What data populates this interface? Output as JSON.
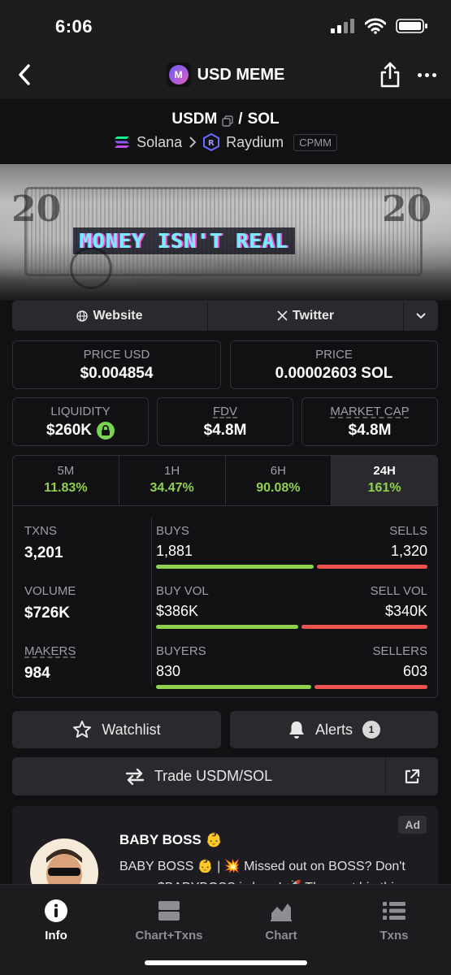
{
  "status_bar": {
    "time": "6:06"
  },
  "nav": {
    "title": "USD MEME",
    "logo_letter": "M"
  },
  "pair": {
    "base": "USDM",
    "separator": "/",
    "quote": "SOL",
    "chain": "Solana",
    "dex": "Raydium",
    "pool_type": "CPMM"
  },
  "banner": {
    "text": "MONEY ISN'T REAL"
  },
  "links": {
    "website": "Website",
    "twitter": "Twitter"
  },
  "price": {
    "usd_label": "PRICE USD",
    "usd_value": "$0.004854",
    "native_label": "PRICE",
    "native_value": "0.00002603 SOL"
  },
  "metrics": {
    "liquidity_label": "LIQUIDITY",
    "liquidity_value": "$260K",
    "fdv_label": "FDV",
    "fdv_value": "$4.8M",
    "mcap_label": "MARKET CAP",
    "mcap_value": "$4.8M"
  },
  "timeframes": [
    {
      "label": "5M",
      "change": "11.83%"
    },
    {
      "label": "1H",
      "change": "34.47%"
    },
    {
      "label": "6H",
      "change": "90.08%"
    },
    {
      "label": "24H",
      "change": "161%"
    }
  ],
  "stats": {
    "txns_label": "TXNS",
    "txns_value": "3,201",
    "buys_label": "BUYS",
    "buys_value": "1,881",
    "sells_label": "SELLS",
    "sells_value": "1,320",
    "volume_label": "VOLUME",
    "volume_value": "$726K",
    "buyvol_label": "BUY VOL",
    "buyvol_value": "$386K",
    "sellvol_label": "SELL VOL",
    "sellvol_value": "$340K",
    "makers_label": "MAKERS",
    "makers_value": "984",
    "buyers_label": "BUYERS",
    "buyers_value": "830",
    "sellers_label": "SELLERS",
    "sellers_value": "603",
    "buy_ratio": 0.5876,
    "buyvol_ratio": 0.5317,
    "buyers_ratio": 0.5792
  },
  "actions": {
    "watchlist": "Watchlist",
    "alerts": "Alerts",
    "alerts_count": "1",
    "trade": "Trade USDM/SOL"
  },
  "ad": {
    "badge": "Ad",
    "title": "BABY BOSS 👶",
    "text": "BABY BOSS 👶 | 💥 Missed out on BOSS? Don't worry, $BABYBOSS is here! 🚀 The next big thing"
  },
  "tabbar": {
    "items": [
      {
        "label": "Info"
      },
      {
        "label": "Chart+Txns"
      },
      {
        "label": "Chart"
      },
      {
        "label": "Txns"
      }
    ]
  },
  "colors": {
    "positive": "#8fd14f",
    "negative": "#ef5350",
    "bg": "#111114",
    "surface": "#2a2a2e"
  }
}
